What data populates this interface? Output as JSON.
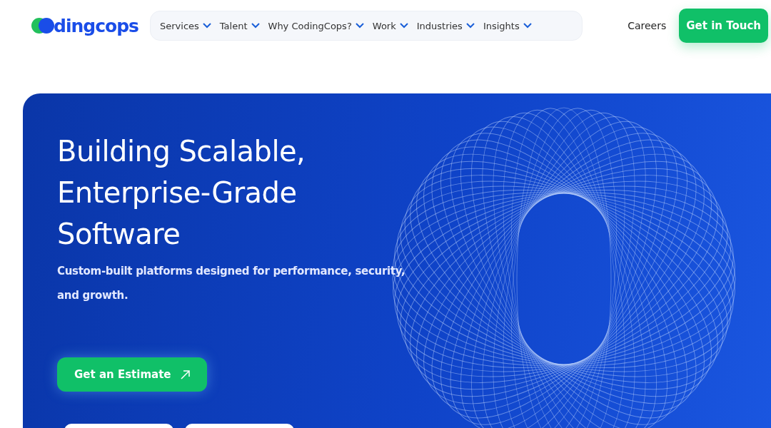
{
  "header": {
    "logo_text": "dingcops",
    "nav": [
      {
        "label": "Services"
      },
      {
        "label": "Talent"
      },
      {
        "label": "Why CodingCops?"
      },
      {
        "label": "Work"
      },
      {
        "label": "Industries"
      },
      {
        "label": "Insights"
      }
    ],
    "careers": "Careers",
    "cta": "Get in Touch"
  },
  "hero": {
    "title_lines": [
      "Building Scalable,",
      "Enterprise-Grade",
      "Software"
    ],
    "subtitle": "Custom-built platforms designed for performance, security, and growth.",
    "button": "Get an Estimate"
  }
}
